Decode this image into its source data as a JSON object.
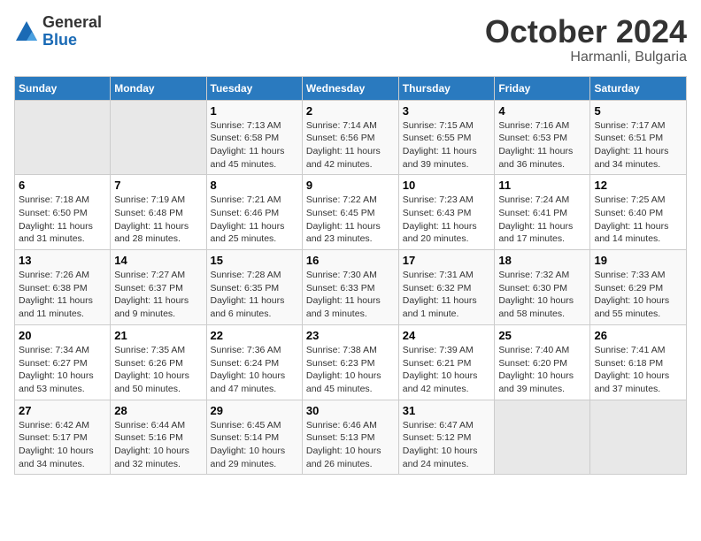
{
  "header": {
    "logo_general": "General",
    "logo_blue": "Blue",
    "month_title": "October 2024",
    "location": "Harmanli, Bulgaria"
  },
  "days_of_week": [
    "Sunday",
    "Monday",
    "Tuesday",
    "Wednesday",
    "Thursday",
    "Friday",
    "Saturday"
  ],
  "weeks": [
    [
      {
        "day": "",
        "empty": true
      },
      {
        "day": "",
        "empty": true
      },
      {
        "day": "1",
        "sunrise": "7:13 AM",
        "sunset": "6:58 PM",
        "daylight": "11 hours and 45 minutes."
      },
      {
        "day": "2",
        "sunrise": "7:14 AM",
        "sunset": "6:56 PM",
        "daylight": "11 hours and 42 minutes."
      },
      {
        "day": "3",
        "sunrise": "7:15 AM",
        "sunset": "6:55 PM",
        "daylight": "11 hours and 39 minutes."
      },
      {
        "day": "4",
        "sunrise": "7:16 AM",
        "sunset": "6:53 PM",
        "daylight": "11 hours and 36 minutes."
      },
      {
        "day": "5",
        "sunrise": "7:17 AM",
        "sunset": "6:51 PM",
        "daylight": "11 hours and 34 minutes."
      }
    ],
    [
      {
        "day": "6",
        "sunrise": "7:18 AM",
        "sunset": "6:50 PM",
        "daylight": "11 hours and 31 minutes."
      },
      {
        "day": "7",
        "sunrise": "7:19 AM",
        "sunset": "6:48 PM",
        "daylight": "11 hours and 28 minutes."
      },
      {
        "day": "8",
        "sunrise": "7:21 AM",
        "sunset": "6:46 PM",
        "daylight": "11 hours and 25 minutes."
      },
      {
        "day": "9",
        "sunrise": "7:22 AM",
        "sunset": "6:45 PM",
        "daylight": "11 hours and 23 minutes."
      },
      {
        "day": "10",
        "sunrise": "7:23 AM",
        "sunset": "6:43 PM",
        "daylight": "11 hours and 20 minutes."
      },
      {
        "day": "11",
        "sunrise": "7:24 AM",
        "sunset": "6:41 PM",
        "daylight": "11 hours and 17 minutes."
      },
      {
        "day": "12",
        "sunrise": "7:25 AM",
        "sunset": "6:40 PM",
        "daylight": "11 hours and 14 minutes."
      }
    ],
    [
      {
        "day": "13",
        "sunrise": "7:26 AM",
        "sunset": "6:38 PM",
        "daylight": "11 hours and 11 minutes."
      },
      {
        "day": "14",
        "sunrise": "7:27 AM",
        "sunset": "6:37 PM",
        "daylight": "11 hours and 9 minutes."
      },
      {
        "day": "15",
        "sunrise": "7:28 AM",
        "sunset": "6:35 PM",
        "daylight": "11 hours and 6 minutes."
      },
      {
        "day": "16",
        "sunrise": "7:30 AM",
        "sunset": "6:33 PM",
        "daylight": "11 hours and 3 minutes."
      },
      {
        "day": "17",
        "sunrise": "7:31 AM",
        "sunset": "6:32 PM",
        "daylight": "11 hours and 1 minute."
      },
      {
        "day": "18",
        "sunrise": "7:32 AM",
        "sunset": "6:30 PM",
        "daylight": "10 hours and 58 minutes."
      },
      {
        "day": "19",
        "sunrise": "7:33 AM",
        "sunset": "6:29 PM",
        "daylight": "10 hours and 55 minutes."
      }
    ],
    [
      {
        "day": "20",
        "sunrise": "7:34 AM",
        "sunset": "6:27 PM",
        "daylight": "10 hours and 53 minutes."
      },
      {
        "day": "21",
        "sunrise": "7:35 AM",
        "sunset": "6:26 PM",
        "daylight": "10 hours and 50 minutes."
      },
      {
        "day": "22",
        "sunrise": "7:36 AM",
        "sunset": "6:24 PM",
        "daylight": "10 hours and 47 minutes."
      },
      {
        "day": "23",
        "sunrise": "7:38 AM",
        "sunset": "6:23 PM",
        "daylight": "10 hours and 45 minutes."
      },
      {
        "day": "24",
        "sunrise": "7:39 AM",
        "sunset": "6:21 PM",
        "daylight": "10 hours and 42 minutes."
      },
      {
        "day": "25",
        "sunrise": "7:40 AM",
        "sunset": "6:20 PM",
        "daylight": "10 hours and 39 minutes."
      },
      {
        "day": "26",
        "sunrise": "7:41 AM",
        "sunset": "6:18 PM",
        "daylight": "10 hours and 37 minutes."
      }
    ],
    [
      {
        "day": "27",
        "sunrise": "6:42 AM",
        "sunset": "5:17 PM",
        "daylight": "10 hours and 34 minutes."
      },
      {
        "day": "28",
        "sunrise": "6:44 AM",
        "sunset": "5:16 PM",
        "daylight": "10 hours and 32 minutes."
      },
      {
        "day": "29",
        "sunrise": "6:45 AM",
        "sunset": "5:14 PM",
        "daylight": "10 hours and 29 minutes."
      },
      {
        "day": "30",
        "sunrise": "6:46 AM",
        "sunset": "5:13 PM",
        "daylight": "10 hours and 26 minutes."
      },
      {
        "day": "31",
        "sunrise": "6:47 AM",
        "sunset": "5:12 PM",
        "daylight": "10 hours and 24 minutes."
      },
      {
        "day": "",
        "empty": true
      },
      {
        "day": "",
        "empty": true
      }
    ]
  ]
}
